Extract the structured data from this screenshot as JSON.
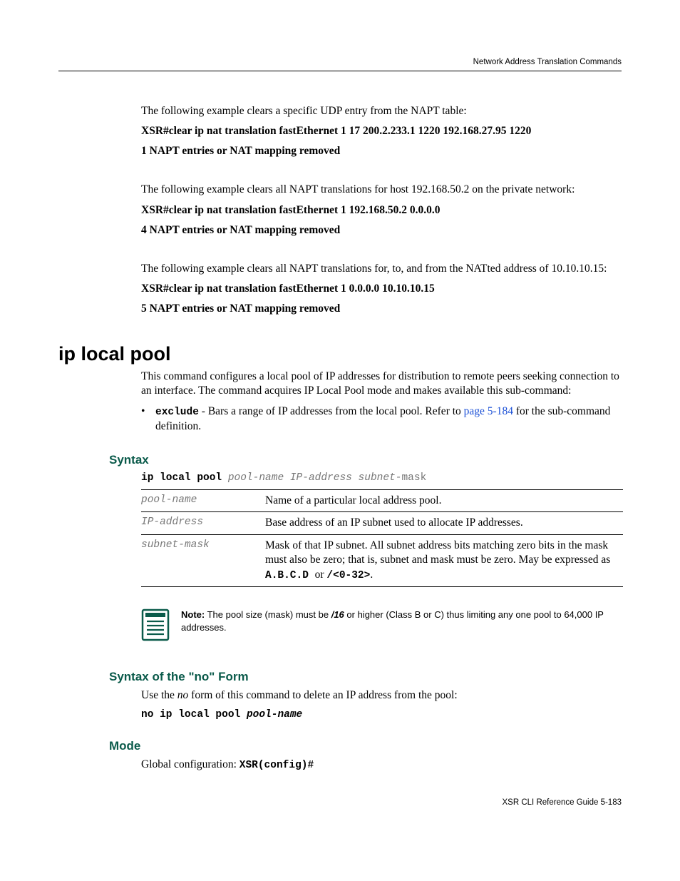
{
  "header": {
    "section": "Network Address Translation Commands"
  },
  "intro": {
    "ex1_lead": "The following example clears a specific UDP entry from the NAPT table:",
    "ex1_cmd": "XSR#clear ip nat translation fastEthernet 1 17 200.2.233.1 1220 192.168.27.95 1220",
    "ex1_result": "1 NAPT entries or NAT mapping removed",
    "ex2_lead": "The following example clears all NAPT translations for host 192.168.50.2 on the private network:",
    "ex2_cmd": "XSR#clear ip nat translation fastEthernet 1 192.168.50.2 0.0.0.0",
    "ex2_result": "4 NAPT entries or NAT mapping removed",
    "ex3_lead": "The following example clears all NAPT translations for, to, and from the NATted address of 10.10.10.15:",
    "ex3_cmd": "XSR#clear ip nat translation fastEthernet 1 0.0.0.0 10.10.10.15",
    "ex3_result": "5 NAPT entries or NAT mapping removed"
  },
  "cmd": {
    "title": "ip local pool",
    "desc": "This command configures a local pool of IP addresses for distribution to remote peers seeking connection to an interface. The command acquires IP Local Pool mode and makes available this sub-command:",
    "bullet_kw": "exclude",
    "bullet_text_a": " - Bars a range of IP addresses from the local pool. Refer to ",
    "bullet_link": "page 5-184",
    "bullet_text_b": " for the sub-command definition."
  },
  "syntax": {
    "heading": "Syntax",
    "cmd_kw": "ip local pool",
    "cmd_args": " pool-name IP-address subnet-",
    "cmd_tail": "mask",
    "rows": [
      {
        "name": "pool-name",
        "desc": "Name of a particular local address pool."
      },
      {
        "name": "IP-address",
        "desc": "Base address of an IP subnet used to allocate IP addresses."
      }
    ],
    "row3": {
      "name": "subnet-mask",
      "desc_a": "Mask of that IP subnet. All subnet address bits matching zero bits in the mask must also be zero; that is, subnet and mask must be zero. May be expressed as ",
      "code_a": "A.B.C.D ",
      "mid": " or ",
      "code_b": "/<0-32>",
      "desc_b": "."
    }
  },
  "note": {
    "label": "Note:",
    "a": " The pool size (mask) must be ",
    "em": "/16",
    "b": " or higher (Class B or C) thus limiting any one pool to 64,000 IP addresses."
  },
  "noform": {
    "heading": "Syntax of the \"no\" Form",
    "lead_a": "Use the ",
    "lead_em": "no",
    "lead_b": " form of this command to delete an IP address from the pool:",
    "cmd_kw": "no ip local pool ",
    "cmd_arg": "pool-name"
  },
  "mode": {
    "heading": "Mode",
    "text": "Global configuration: ",
    "code": "XSR(config)#"
  },
  "footer": {
    "text": "XSR CLI Reference Guide   5-183"
  }
}
